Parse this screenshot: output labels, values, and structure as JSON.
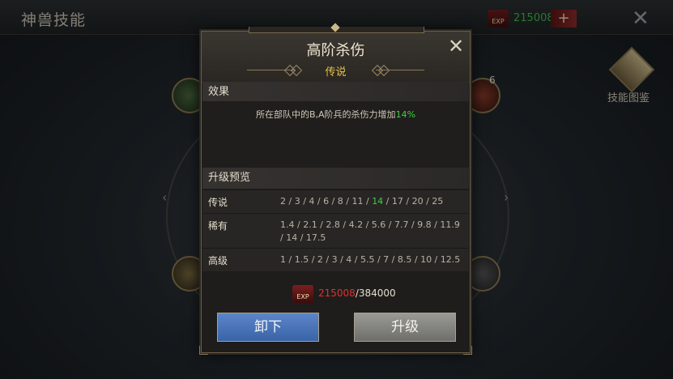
{
  "background": {
    "title": "神兽技能",
    "exp_icon_text": "EXP",
    "exp_value": "215008",
    "plus_label": "+",
    "close_label": "✕",
    "node_badge": "6",
    "library_label": "技能图鉴"
  },
  "dialog": {
    "title": "高阶杀伤",
    "close_label": "✕",
    "rarity": "传说",
    "effect_header": "效果",
    "effect_prefix": "所在部队中的B,A阶兵的杀伤力增加",
    "effect_value": "14",
    "effect_suffix": "%",
    "preview_header": "升级预览",
    "preview_rows": [
      {
        "label": "传说",
        "pre": "2 / 3 / 4 / 6 / 8 / 11 / ",
        "cur": "14",
        "post": " / 17 / 20 / 25"
      },
      {
        "label": "稀有",
        "pre": "1.4 / 2.1 / 2.8 / 4.2 / 5.6 / 7.7 / 9.8 / 11.9 / 14 / 17.5",
        "cur": "",
        "post": ""
      },
      {
        "label": "高级",
        "pre": "1 / 1.5 / 2 / 3 / 4 / 5.5 / 7 / 8.5 / 10 / 12.5",
        "cur": "",
        "post": ""
      }
    ],
    "cost": {
      "icon_text": "EXP",
      "have": "215008",
      "separator": "/",
      "need": "384000"
    },
    "buttons": {
      "unequip": "卸下",
      "upgrade": "升级"
    }
  },
  "colors": {
    "rarity": "#e6c04a",
    "highlight": "#40d040",
    "insufficient": "#e03030",
    "unequip_button": "#4a76b8",
    "upgrade_button": "#858581"
  }
}
